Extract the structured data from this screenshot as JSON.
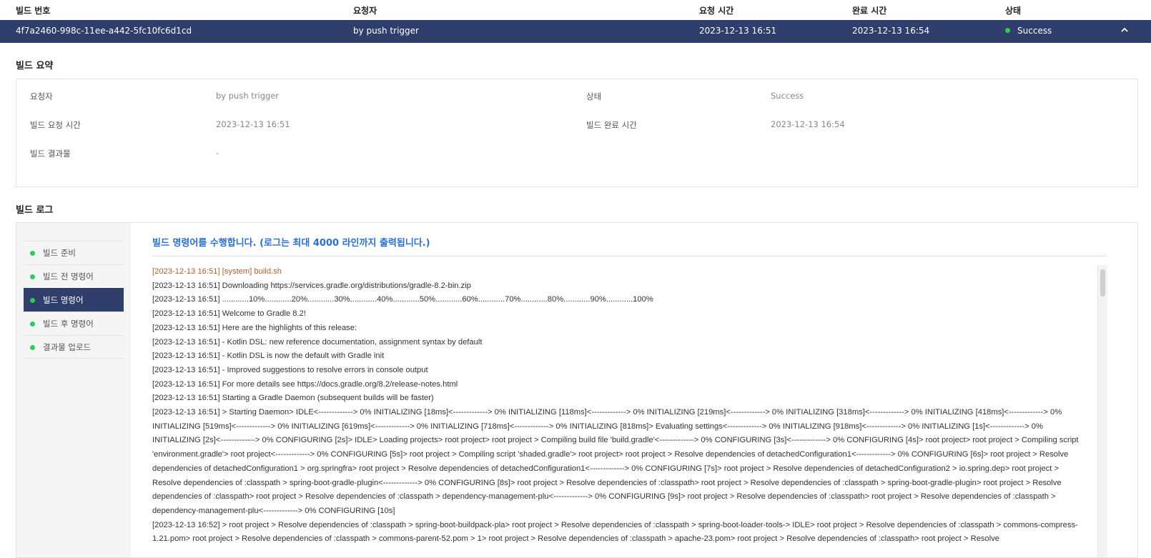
{
  "table": {
    "headers": {
      "build_id": "빌드 번호",
      "requester": "요청자",
      "request_time": "요청 시간",
      "complete_time": "완료 시간",
      "status": "상태"
    },
    "row": {
      "build_id": "4f7a2460-998c-11ee-a442-5fc10fc6d1cd",
      "requester": "by push trigger",
      "request_time": "2023-12-13 16:51",
      "complete_time": "2023-12-13 16:54",
      "status": "Success"
    }
  },
  "summary": {
    "title": "빌드 요약",
    "requester_label": "요청자",
    "requester_value": "by push trigger",
    "status_label": "상태",
    "status_value": "Success",
    "request_time_label": "빌드 요청 시간",
    "request_time_value": "2023-12-13 16:51",
    "complete_time_label": "빌드 완료 시간",
    "complete_time_value": "2023-12-13 16:54",
    "artifact_label": "빌드 결과물",
    "artifact_value": "-"
  },
  "log": {
    "title": "빌드 로그",
    "nav": [
      {
        "label": "빌드 준비"
      },
      {
        "label": "빌드 전 명령어"
      },
      {
        "label": "빌드 명령어"
      },
      {
        "label": "빌드 후 명령어"
      },
      {
        "label": "결과물 업로드"
      }
    ],
    "heading": "빌드 명령어를 수행합니다. (로그는 최대 4000 라인까지 출력됩니다.)",
    "lines": [
      "[2023-12-13 16:51] [system] build.sh",
      "[2023-12-13 16:51] Downloading https://services.gradle.org/distributions/gradle-8.2-bin.zip",
      "[2023-12-13 16:51] ............10%............20%............30%............40%............50%............60%............70%............80%............90%............100%",
      "[2023-12-13 16:51] Welcome to Gradle 8.2!",
      "[2023-12-13 16:51] Here are the highlights of this release:",
      "[2023-12-13 16:51] - Kotlin DSL: new reference documentation, assignment syntax by default",
      "[2023-12-13 16:51] - Kotlin DSL is now the default with Gradle init",
      "[2023-12-13 16:51] - Improved suggestions to resolve errors in console output",
      "[2023-12-13 16:51] For more details see https://docs.gradle.org/8.2/release-notes.html",
      "[2023-12-13 16:51] Starting a Gradle Daemon (subsequent builds will be faster)",
      "[2023-12-13 16:51] > Starting Daemon> IDLE<-------------> 0% INITIALIZING [18ms]<-------------> 0% INITIALIZING [118ms]<-------------> 0% INITIALIZING [219ms]<-------------> 0% INITIALIZING [318ms]<-------------> 0% INITIALIZING [418ms]<-------------> 0% INITIALIZING [519ms]<-------------> 0% INITIALIZING [619ms]<-------------> 0% INITIALIZING [718ms]<-------------> 0% INITIALIZING [818ms]> Evaluating settings<-------------> 0% INITIALIZING [918ms]<-------------> 0% INITIALIZING [1s]<-------------> 0% INITIALIZING [2s]<-------------> 0% CONFIGURING [2s]> IDLE> Loading projects> root project> root project > Compiling build file 'build.gradle'<-------------> 0% CONFIGURING [3s]<-------------> 0% CONFIGURING [4s]> root project> root project > Compiling script 'environment.gradle'> root project<-------------> 0% CONFIGURING [5s]> root project > Compiling script 'shaded.gradle'> root project> root project > Resolve dependencies of detachedConfiguration1<-------------> 0% CONFIGURING [6s]> root project > Resolve dependencies of detachedConfiguration1 > org.springfra> root project > Resolve dependencies of detachedConfiguration1<-------------> 0% CONFIGURING [7s]> root project > Resolve dependencies of detachedConfiguration2 > io.spring.dep> root project > Resolve dependencies of :classpath > spring-boot-gradle-plugin<-------------> 0% CONFIGURING [8s]> root project > Resolve dependencies of :classpath> root project > Resolve dependencies of :classpath > spring-boot-gradle-plugin> root project > Resolve dependencies of :classpath> root project > Resolve dependencies of :classpath > dependency-management-plu<-------------> 0% CONFIGURING [9s]> root project > Resolve dependencies of :classpath> root project > Resolve dependencies of :classpath > dependency-management-plu<-------------> 0% CONFIGURING [10s]",
      "[2023-12-13 16:52] > root project > Resolve dependencies of :classpath > spring-boot-buildpack-pla> root project > Resolve dependencies of :classpath > spring-boot-loader-tools-> IDLE> root project > Resolve dependencies of :classpath > commons-compress-1.21.pom> root project > Resolve dependencies of :classpath > commons-parent-52.pom > 1> root project > Resolve dependencies of :classpath > apache-23.pom> root project > Resolve dependencies of :classpath> root project > Resolve"
    ]
  }
}
